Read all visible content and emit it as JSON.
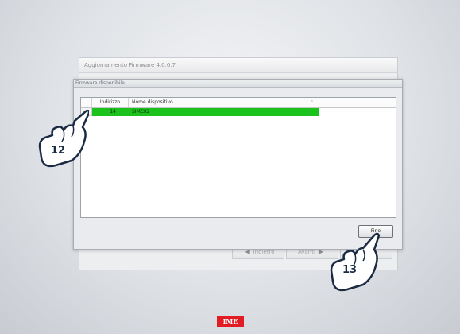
{
  "app": {
    "window_title": "Aggiornamento Firmware 4.0.0.7",
    "buttons": {
      "back": "Indietro",
      "next": "Avanti",
      "extra": ""
    }
  },
  "dialog": {
    "title": "Firmware disponibile",
    "columns": {
      "address": "Indirizzo",
      "device_name": "Nome dispositivo"
    },
    "rows": [
      {
        "address": "14",
        "device_name": "SIMCK2",
        "highlight_color": "#1cc21c"
      }
    ],
    "ok_button": "Fine"
  },
  "callouts": [
    {
      "number": "12",
      "icon": "pointing-hand-icon"
    },
    {
      "number": "13",
      "icon": "pointing-hand-icon"
    }
  ],
  "footer": {
    "logo": "IME",
    "logo_color": "#e31b23"
  }
}
